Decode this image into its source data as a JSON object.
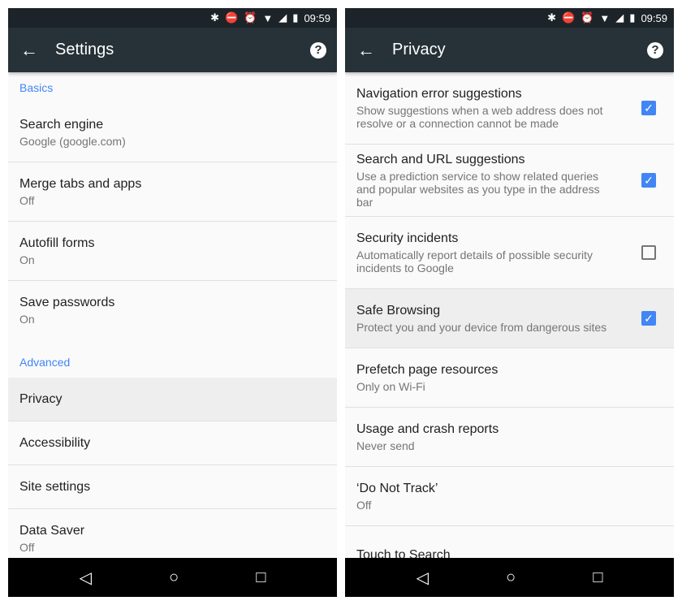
{
  "status": {
    "time": "09:59"
  },
  "left": {
    "title": "Settings",
    "sections": [
      {
        "label": "Basics",
        "items": [
          {
            "title": "Search engine",
            "sub": "Google (google.com)"
          },
          {
            "title": "Merge tabs and apps",
            "sub": "Off"
          },
          {
            "title": "Autofill forms",
            "sub": "On"
          },
          {
            "title": "Save passwords",
            "sub": "On"
          }
        ]
      },
      {
        "label": "Advanced",
        "items": [
          {
            "title": "Privacy",
            "selected": true
          },
          {
            "title": "Accessibility"
          },
          {
            "title": "Site settings"
          },
          {
            "title": "Data Saver",
            "sub": "Off"
          }
        ]
      }
    ]
  },
  "right": {
    "title": "Privacy",
    "items": [
      {
        "title": "Navigation error suggestions",
        "sub": "Show suggestions when a web address does not resolve or a connection cannot be made",
        "checked": true
      },
      {
        "title": "Search and URL suggestions",
        "sub": "Use a prediction service to show related queries and popular websites as you type in the address bar",
        "checked": true
      },
      {
        "title": "Security incidents",
        "sub": "Automatically report details of possible security incidents to Google",
        "checked": false
      },
      {
        "title": "Safe Browsing",
        "sub": "Protect you and your device from dangerous sites",
        "checked": true,
        "selected": true
      },
      {
        "title": "Prefetch page resources",
        "sub": "Only on Wi-Fi"
      },
      {
        "title": "Usage and crash reports",
        "sub": "Never send"
      },
      {
        "title": "‘Do Not Track’",
        "sub": "Off"
      },
      {
        "title": "Touch to Search"
      }
    ]
  },
  "colors": {
    "toolbar": "#263238",
    "accent": "#4285f4"
  }
}
